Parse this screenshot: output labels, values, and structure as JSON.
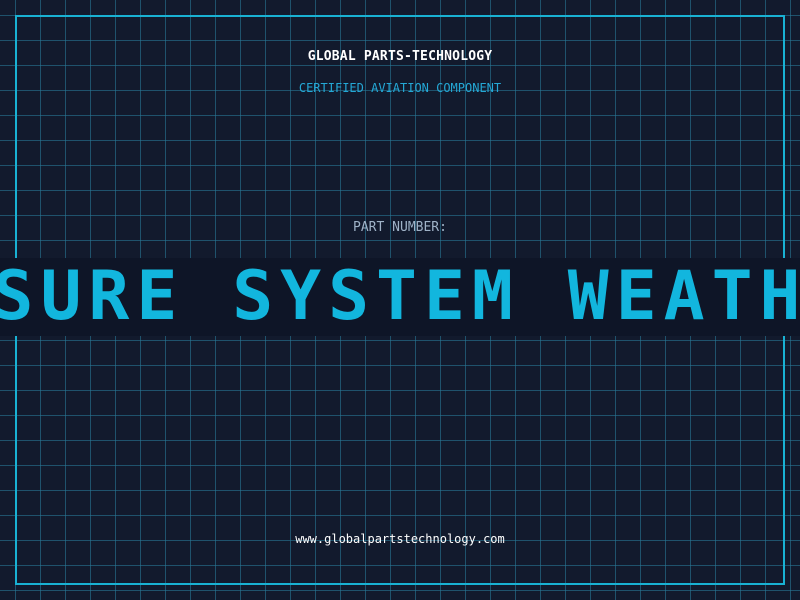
{
  "header": {
    "company_name": "GLOBAL PARTS-TECHNOLOGY",
    "subtitle": "CERTIFIED AVIATION COMPONENT"
  },
  "part": {
    "label": "PART NUMBER:",
    "value": "SSURE SYSTEM WEATHE"
  },
  "footer": {
    "website": "www.globalpartstechnology.com"
  },
  "colors": {
    "background": "#121a2d",
    "frame": "#19b1d3",
    "grid": "#2b7a9a",
    "accent": "#12b6de",
    "band": "#0e1527"
  }
}
